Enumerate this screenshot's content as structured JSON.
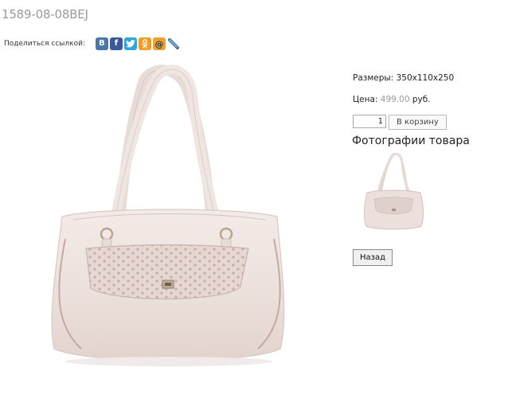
{
  "product": {
    "code": "1589-08-08BEJ",
    "sizes_label": "Размеры:",
    "sizes_value": "350x110x250",
    "price_label": "Цена:",
    "price_value": "499.00",
    "currency": "руб."
  },
  "share": {
    "label": "Поделиться ссылкой:",
    "icons": [
      {
        "name": "vkontakte-icon",
        "glyph": "В",
        "color": "#4a76a8"
      },
      {
        "name": "facebook-icon",
        "glyph": "f",
        "color": "#3b5998"
      },
      {
        "name": "twitter-icon",
        "glyph": "",
        "color": "#2fa5e0"
      },
      {
        "name": "odnoklassniki-icon",
        "glyph": "",
        "color": "#f59a23"
      },
      {
        "name": "mail-ru-icon",
        "glyph": "@",
        "color": "#f0a12e"
      },
      {
        "name": "livejournal-icon",
        "glyph": "",
        "color": "#2d6da0"
      }
    ]
  },
  "cart": {
    "quantity": "1",
    "add_to_cart_label": "В корзину"
  },
  "photos": {
    "heading": "Фотографии товара"
  },
  "nav": {
    "back_label": "Назад"
  },
  "colors": {
    "bag_body": "#eee3df",
    "bag_shadow": "#d7c6c0",
    "hardware": "#b8a58e"
  }
}
